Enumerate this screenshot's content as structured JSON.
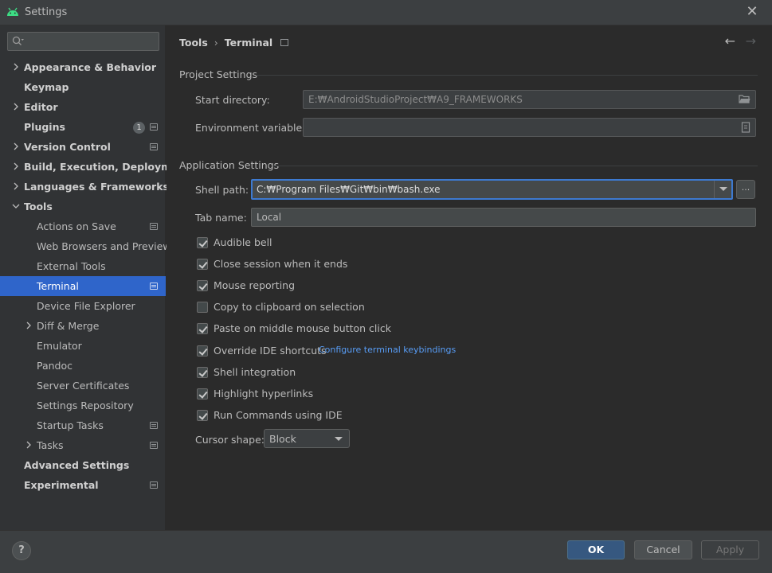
{
  "window": {
    "title": "Settings"
  },
  "search": {
    "placeholder": "",
    "value": ""
  },
  "sidebar": {
    "items": [
      {
        "label": "Appearance & Behavior",
        "expandable": true,
        "expanded": false,
        "bold": true
      },
      {
        "label": "Keymap",
        "bold": true
      },
      {
        "label": "Editor",
        "expandable": true,
        "expanded": false,
        "bold": true
      },
      {
        "label": "Plugins",
        "bold": true,
        "badge": "1",
        "project_icon": true
      },
      {
        "label": "Version Control",
        "expandable": true,
        "expanded": false,
        "bold": true,
        "project_icon": true
      },
      {
        "label": "Build, Execution, Deployment",
        "expandable": true,
        "expanded": false,
        "bold": true
      },
      {
        "label": "Languages & Frameworks",
        "expandable": true,
        "expanded": false,
        "bold": true
      },
      {
        "label": "Tools",
        "expandable": true,
        "expanded": true,
        "bold": true
      },
      {
        "label": "Actions on Save",
        "child": true,
        "project_icon": true
      },
      {
        "label": "Web Browsers and Preview",
        "child": true
      },
      {
        "label": "External Tools",
        "child": true
      },
      {
        "label": "Terminal",
        "child": true,
        "selected": true,
        "project_icon": true
      },
      {
        "label": "Device File Explorer",
        "child": true
      },
      {
        "label": "Diff & Merge",
        "child": true,
        "expandable": true,
        "expanded": false
      },
      {
        "label": "Emulator",
        "child": true
      },
      {
        "label": "Pandoc",
        "child": true
      },
      {
        "label": "Server Certificates",
        "child": true
      },
      {
        "label": "Settings Repository",
        "child": true
      },
      {
        "label": "Startup Tasks",
        "child": true,
        "project_icon": true
      },
      {
        "label": "Tasks",
        "child": true,
        "expandable": true,
        "expanded": false,
        "project_icon": true
      },
      {
        "label": "Advanced Settings",
        "bold": true
      },
      {
        "label": "Experimental",
        "bold": true,
        "project_icon": true
      }
    ]
  },
  "breadcrumb": {
    "parent": "Tools",
    "current": "Terminal"
  },
  "project_settings": {
    "title": "Project Settings",
    "start_directory_label": "Start directory:",
    "start_directory_value": "E:₩AndroidStudioProject₩A9_FRAMEWORKS",
    "env_vars_label": "Environment variables:",
    "env_vars_value": ""
  },
  "application_settings": {
    "title": "Application Settings",
    "shell_path_label": "Shell path:",
    "shell_path_value": "C:₩Program Files₩Git₩bin₩bash.exe",
    "ellipsis_label": "...",
    "tab_name_label": "Tab name:",
    "tab_name_value": "Local",
    "checkboxes": [
      {
        "label": "Audible bell",
        "checked": true
      },
      {
        "label": "Close session when it ends",
        "checked": true
      },
      {
        "label": "Mouse reporting",
        "checked": true
      },
      {
        "label": "Copy to clipboard on selection",
        "checked": false
      },
      {
        "label": "Paste on middle mouse button click",
        "checked": true
      },
      {
        "label": "Override IDE shortcuts",
        "checked": true
      },
      {
        "label": "Shell integration",
        "checked": true
      },
      {
        "label": "Highlight hyperlinks",
        "checked": true
      },
      {
        "label": "Run Commands using IDE",
        "checked": true
      }
    ],
    "keybindings_link": "Configure terminal keybindings",
    "cursor_shape_label": "Cursor shape:",
    "cursor_shape_value": "Block"
  },
  "footer": {
    "help_label": "?",
    "ok_label": "OK",
    "cancel_label": "Cancel",
    "apply_label": "Apply"
  },
  "colors": {
    "accent": "#2f65ca",
    "link": "#589df6",
    "android_green": "#3ddc84"
  }
}
